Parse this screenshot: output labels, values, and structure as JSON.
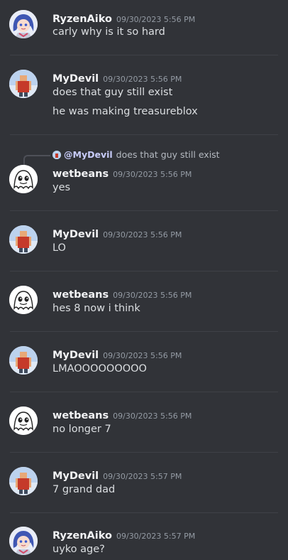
{
  "messages": [
    {
      "author": "RyzenAiko",
      "time": "09/30/2023 5:56 PM",
      "lines": [
        "carly why is it so hard"
      ],
      "avatar": "anime-avatar"
    },
    {
      "author": "MyDevil",
      "time": "09/30/2023 5:56 PM",
      "lines": [
        "does that guy still exist",
        "he was making treasureblox"
      ],
      "avatar": "roblox-avatar"
    },
    {
      "author": "wetbeans",
      "time": "09/30/2023 5:56 PM",
      "lines": [
        "yes"
      ],
      "avatar": "ghost-avatar",
      "reply": {
        "mention": "@MyDevil",
        "text": "does that guy still exist"
      }
    },
    {
      "author": "MyDevil",
      "time": "09/30/2023 5:56 PM",
      "lines": [
        "LO"
      ],
      "avatar": "roblox-avatar"
    },
    {
      "author": "wetbeans",
      "time": "09/30/2023 5:56 PM",
      "lines": [
        "hes 8 now i think"
      ],
      "avatar": "ghost-avatar"
    },
    {
      "author": "MyDevil",
      "time": "09/30/2023 5:56 PM",
      "lines": [
        "LMAOOOOOOOOO"
      ],
      "avatar": "roblox-avatar"
    },
    {
      "author": "wetbeans",
      "time": "09/30/2023 5:56 PM",
      "lines": [
        "no longer 7"
      ],
      "avatar": "ghost-avatar"
    },
    {
      "author": "MyDevil",
      "time": "09/30/2023 5:57 PM",
      "lines": [
        "7 grand dad"
      ],
      "avatar": "roblox-avatar"
    },
    {
      "author": "RyzenAiko",
      "time": "09/30/2023 5:57 PM",
      "lines": [
        "uyko age?"
      ],
      "avatar": "anime-avatar"
    }
  ],
  "colors": {
    "background": "#313338",
    "author": "#f2f3f5",
    "text": "#dbdee1",
    "timestamp": "#949ba4",
    "mention": "#c9cdfb"
  }
}
